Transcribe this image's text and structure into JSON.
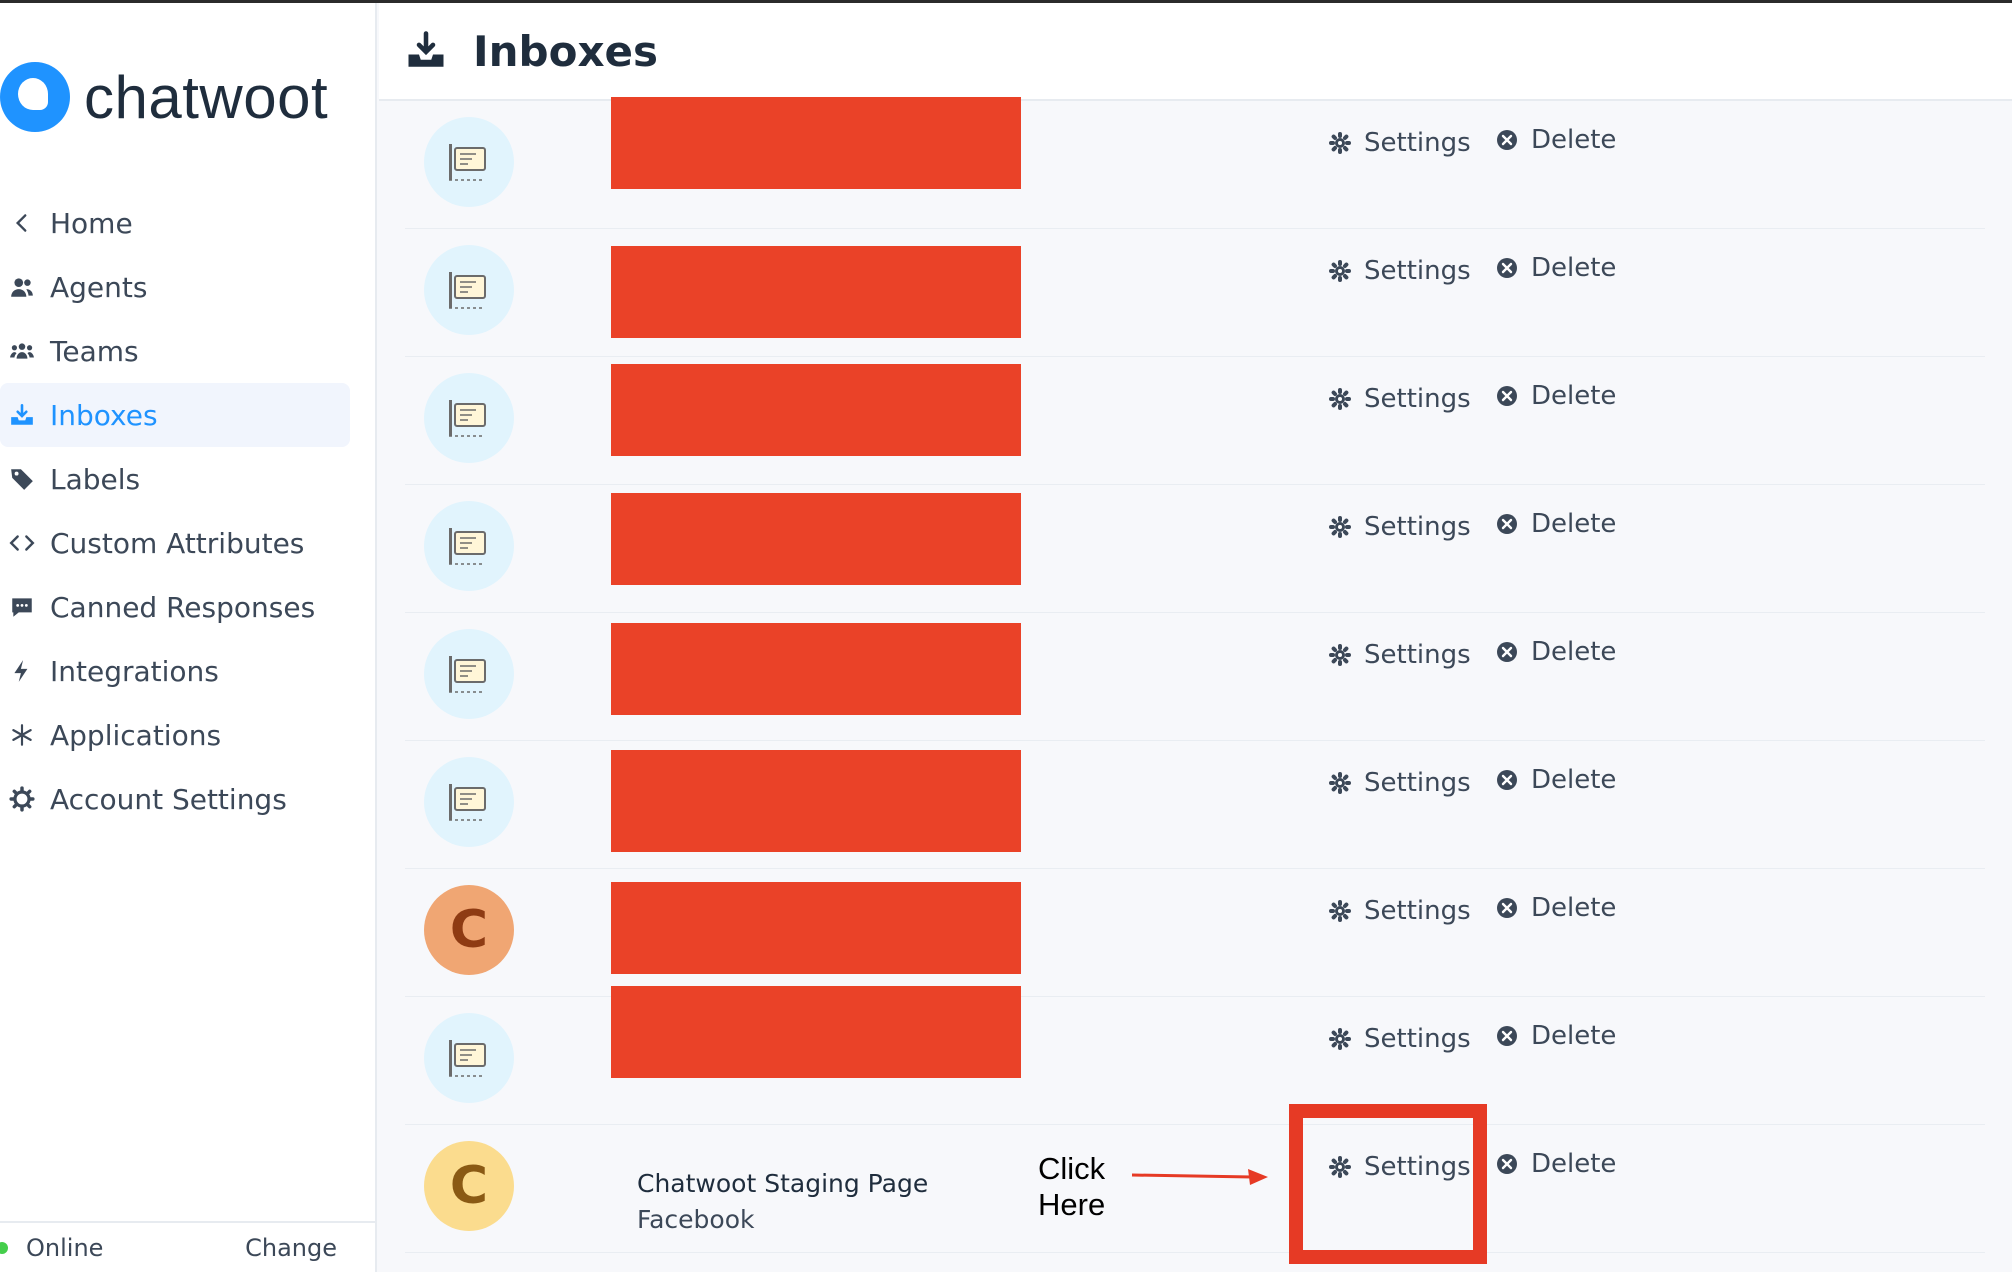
{
  "sidebar": {
    "brand": "chatwoot",
    "items": [
      {
        "label": "Home",
        "icon": "chevron-left-icon"
      },
      {
        "label": "Agents",
        "icon": "agents-icon"
      },
      {
        "label": "Teams",
        "icon": "teams-icon"
      },
      {
        "label": "Inboxes",
        "icon": "inbox-icon",
        "active": true
      },
      {
        "label": "Labels",
        "icon": "tag-icon"
      },
      {
        "label": "Custom Attributes",
        "icon": "code-icon"
      },
      {
        "label": "Canned Responses",
        "icon": "chat-icon"
      },
      {
        "label": "Integrations",
        "icon": "lightning-icon"
      },
      {
        "label": "Applications",
        "icon": "asterisk-icon"
      },
      {
        "label": "Account Settings",
        "icon": "gear-icon"
      }
    ],
    "status": {
      "label": "Online",
      "change": "Change"
    }
  },
  "header": {
    "title": "Inboxes"
  },
  "actions": {
    "settings": "Settings",
    "delete": "Delete"
  },
  "inboxes": [
    {
      "avatar": "channel-icon",
      "redacted": true
    },
    {
      "avatar": "channel-icon",
      "redacted": true
    },
    {
      "avatar": "channel-icon",
      "redacted": true
    },
    {
      "avatar": "channel-icon",
      "redacted": true
    },
    {
      "avatar": "channel-icon",
      "redacted": true
    },
    {
      "avatar": "channel-icon",
      "redacted": true
    },
    {
      "avatar": "C",
      "avatar_color": "orange",
      "redacted": true
    },
    {
      "avatar": "channel-icon",
      "redacted": true
    },
    {
      "avatar": "C",
      "avatar_color": "yellow",
      "redacted": false,
      "name": "Chatwoot Staging Page",
      "type": "Facebook"
    }
  ],
  "annotation": {
    "line1": "Click",
    "line2": "Here"
  },
  "colors": {
    "accent": "#1f93ff",
    "redaction": "#ea4228",
    "highlight": "#e63a25",
    "online": "#44ce4b"
  }
}
